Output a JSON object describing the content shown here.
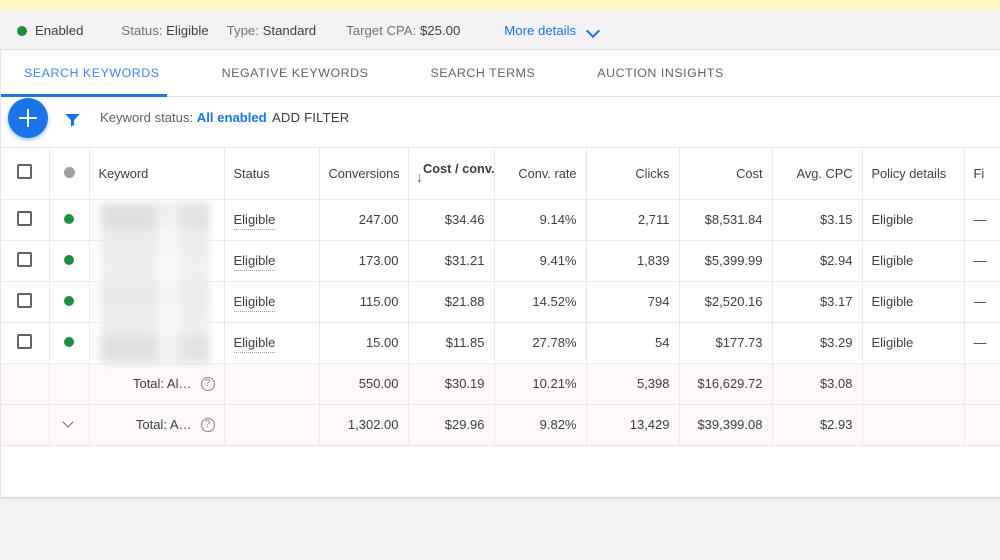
{
  "status_bar": {
    "state_label": "Enabled",
    "state_dot_color": "#1e8e3e",
    "status_label": "Status:",
    "status_value": "Eligible",
    "type_label": "Type:",
    "type_value": "Standard",
    "target_cpa_label": "Target CPA:",
    "target_cpa_value": "$25.00",
    "more_details": "More details",
    "more_details_icon": "chevron-down-icon"
  },
  "tabs": [
    {
      "label": "SEARCH KEYWORDS",
      "active": true
    },
    {
      "label": "NEGATIVE KEYWORDS",
      "active": false
    },
    {
      "label": "SEARCH TERMS",
      "active": false
    },
    {
      "label": "AUCTION INSIGHTS",
      "active": false
    }
  ],
  "toolbar": {
    "add_icon": "plus-icon",
    "filter_icon": "funnel-icon",
    "filter_prefix": "Keyword status:",
    "filter_value": "All enabled",
    "add_filter": "ADD FILTER",
    "accent_color": "#1a73e8"
  },
  "table": {
    "columns": [
      {
        "key": "select",
        "label": "",
        "align": "center"
      },
      {
        "key": "statusdot",
        "label": "",
        "align": "center"
      },
      {
        "key": "keyword",
        "label": "Keyword",
        "align": "left"
      },
      {
        "key": "status",
        "label": "Status",
        "align": "left"
      },
      {
        "key": "conversions",
        "label": "Conversions",
        "align": "right"
      },
      {
        "key": "cost_conv",
        "label": "Cost / conv.",
        "align": "right",
        "sorted": true,
        "sort_dir": "desc"
      },
      {
        "key": "conv_rate",
        "label": "Conv. rate",
        "align": "right"
      },
      {
        "key": "clicks",
        "label": "Clicks",
        "align": "right"
      },
      {
        "key": "cost",
        "label": "Cost",
        "align": "right"
      },
      {
        "key": "avg_cpc",
        "label": "Avg. CPC",
        "align": "right"
      },
      {
        "key": "policy",
        "label": "Policy details",
        "align": "left"
      },
      {
        "key": "final_url",
        "label": "Fi",
        "align": "left"
      }
    ],
    "sort_icon": "arrow-down-icon",
    "rows": [
      {
        "keyword": "",
        "keyword_redacted": true,
        "status": "Eligible",
        "conversions": "247.00",
        "cost_conv": "$34.46",
        "conv_rate": "9.14%",
        "clicks": "2,711",
        "cost": "$8,531.84",
        "avg_cpc": "$3.15",
        "policy": "Eligible",
        "final_url": "—"
      },
      {
        "keyword": "",
        "keyword_redacted": true,
        "status": "Eligible",
        "conversions": "173.00",
        "cost_conv": "$31.21",
        "conv_rate": "9.41%",
        "clicks": "1,839",
        "cost": "$5,399.99",
        "avg_cpc": "$2.94",
        "policy": "Eligible",
        "final_url": "—"
      },
      {
        "keyword": "",
        "keyword_redacted": true,
        "status": "Eligible",
        "conversions": "115.00",
        "cost_conv": "$21.88",
        "conv_rate": "14.52%",
        "clicks": "794",
        "cost": "$2,520.16",
        "avg_cpc": "$3.17",
        "policy": "Eligible",
        "final_url": "—"
      },
      {
        "keyword": "",
        "keyword_redacted": true,
        "status": "Eligible",
        "conversions": "15.00",
        "cost_conv": "$11.85",
        "conv_rate": "27.78%",
        "clicks": "54",
        "cost": "$177.73",
        "avg_cpc": "$3.29",
        "policy": "Eligible",
        "final_url": "—"
      }
    ],
    "totals": [
      {
        "label": "Total: Al…",
        "help_icon": "help-icon",
        "expander": false,
        "conversions": "550.00",
        "cost_conv": "$30.19",
        "conv_rate": "10.21%",
        "clicks": "5,398",
        "cost": "$16,629.72",
        "avg_cpc": "$3.08",
        "policy": "",
        "final_url": ""
      },
      {
        "label": "Total: A…",
        "help_icon": "help-icon",
        "expander": true,
        "conversions": "1,302.00",
        "cost_conv": "$29.96",
        "conv_rate": "9.82%",
        "clicks": "13,429",
        "cost": "$39,399.08",
        "avg_cpc": "$2.93",
        "policy": "",
        "final_url": ""
      }
    ]
  }
}
